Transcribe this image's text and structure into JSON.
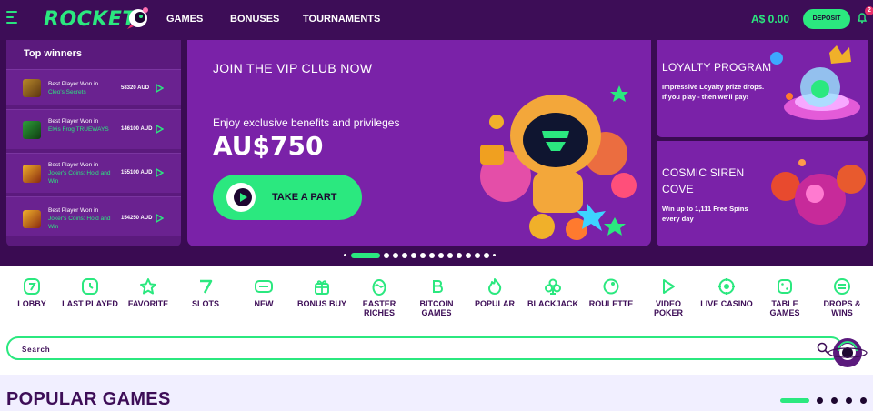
{
  "header": {
    "logo": "ROCKET",
    "nav": [
      "GAMES",
      "BONUSES",
      "TOURNAMENTS"
    ],
    "balance": "A$ 0.00",
    "deposit_label": "DEPOSIT",
    "notification_count": "2"
  },
  "winners": {
    "title": "Top winners",
    "items": [
      {
        "caption": "Best Player Won in",
        "game": "Cleo's Secrets",
        "amount": "58320 AUD"
      },
      {
        "caption": "Best Player Won in",
        "game": "Elvis Frog TRUEWAYS",
        "amount": "146100 AUD"
      },
      {
        "caption": "Best Player Won in",
        "game": "Joker's Coins: Hold and Win",
        "amount": "155100 AUD"
      },
      {
        "caption": "Best Player Won in",
        "game": "Joker's Coins: Hold and Win",
        "amount": "154250 AUD"
      }
    ]
  },
  "vip": {
    "title": "JOIN THE VIP CLUB NOW",
    "subtitle": "Enjoy exclusive benefits and privileges",
    "amount": "AU$750",
    "button_label": "TAKE A PART"
  },
  "promos": [
    {
      "title": "LOYALTY PROGRAM",
      "text": "Impressive Loyalty prize drops. If you play - then we'll pay!"
    },
    {
      "title": "COSMIC SIREN COVE",
      "text": "Win up to 1,111 Free Spins every day"
    }
  ],
  "carousel": {
    "total": 15,
    "active_index": 1
  },
  "categories": [
    {
      "label": "LOBBY",
      "icon": "lobby-icon"
    },
    {
      "label": "LAST PLAYED",
      "icon": "clock-icon"
    },
    {
      "label": "FAVORITE",
      "icon": "star-icon"
    },
    {
      "label": "SLOTS",
      "icon": "seven-icon"
    },
    {
      "label": "NEW",
      "icon": "new-icon"
    },
    {
      "label": "BONUS BUY",
      "icon": "gift-icon"
    },
    {
      "label": "EASTER RICHES",
      "icon": "egg-icon"
    },
    {
      "label": "BITCOIN GAMES",
      "icon": "bitcoin-icon"
    },
    {
      "label": "POPULAR",
      "icon": "fire-icon"
    },
    {
      "label": "BLACKJACK",
      "icon": "club-icon"
    },
    {
      "label": "ROULETTE",
      "icon": "roulette-icon"
    },
    {
      "label": "VIDEO POKER",
      "icon": "play-icon"
    },
    {
      "label": "LIVE CASINO",
      "icon": "live-icon"
    },
    {
      "label": "TABLE GAMES",
      "icon": "dice-icon"
    },
    {
      "label": "DROPS & WINS",
      "icon": "drops-icon"
    }
  ],
  "search": {
    "placeholder": "Search"
  },
  "section": {
    "title": "POPULAR GAMES"
  },
  "colors": {
    "accent": "#2be87f",
    "header_bg": "#3d0d57",
    "panel_bg": "#7a22a8",
    "text_dark": "#3d0d57"
  }
}
